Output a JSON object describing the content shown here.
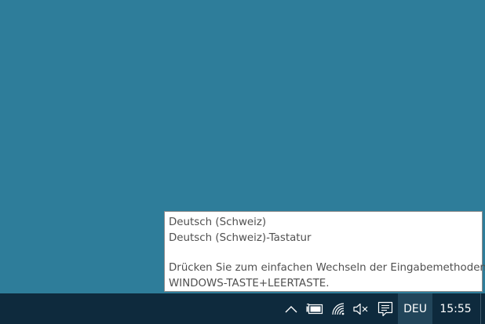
{
  "tooltip": {
    "language": "Deutsch (Schweiz)",
    "keyboard": "Deutsch (Schweiz)-Tastatur",
    "hint_line1": "Drücken Sie zum einfachen Wechseln der Eingabemethoden",
    "hint_line2": "WINDOWS-TASTE+LEERTASTE."
  },
  "taskbar": {
    "language_indicator": "DEU",
    "clock": "15:55",
    "tray_icons": [
      "chevron-up-icon",
      "battery-icon",
      "wifi-icon",
      "volume-muted-icon",
      "action-center-icon"
    ]
  },
  "colors": {
    "desktop": "#2e7d9a",
    "taskbar": "#0e2a3d",
    "language_highlight": "#22455a",
    "tooltip_bg": "#ffffff",
    "tooltip_text": "#505050"
  }
}
